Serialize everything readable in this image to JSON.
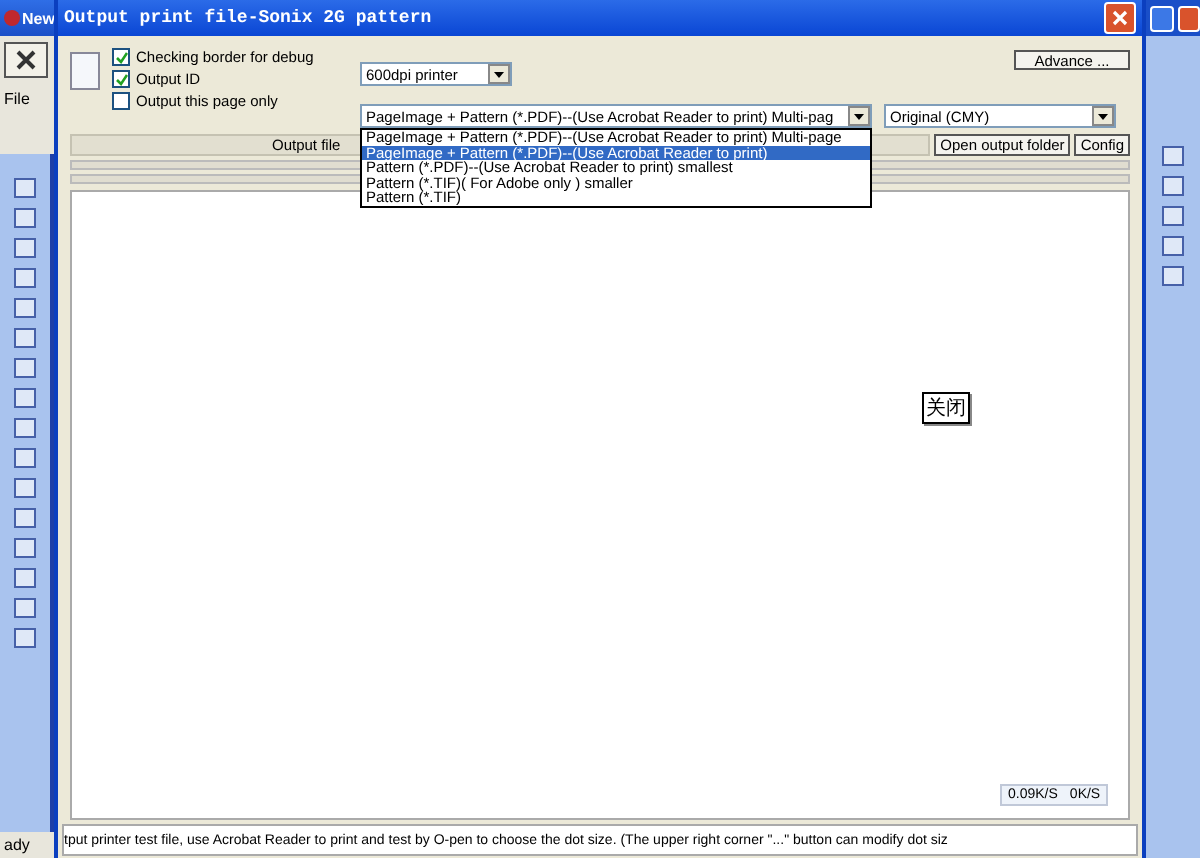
{
  "background_app": {
    "title": "New",
    "menu": [
      "File"
    ],
    "status": "ady"
  },
  "window": {
    "title": "Output print file-Sonix 2G pattern"
  },
  "options": [
    {
      "label": "Checking border for debug",
      "checked": true
    },
    {
      "label": "Output ID",
      "checked": true
    },
    {
      "label": "Output this page only",
      "checked": false
    }
  ],
  "printer_select": {
    "value": "600dpi printer"
  },
  "advance_button": "Advance ...",
  "format_select": {
    "value": "PageImage + Pattern (*.PDF)--(Use Acrobat Reader to print) Multi-pag",
    "expanded": true,
    "options": [
      {
        "label": "PageImage + Pattern (*.PDF)--(Use Acrobat Reader to print) Multi-page",
        "selected": false
      },
      {
        "label": "PageImage + Pattern (*.PDF)--(Use Acrobat Reader to print)",
        "selected": true
      },
      {
        "label": "Pattern (*.PDF)--(Use Acrobat Reader to print) smallest",
        "selected": false
      },
      {
        "label": "Pattern (*.TIF)( For Adobe only ) smaller",
        "selected": false
      },
      {
        "label": "Pattern (*.TIF)",
        "selected": false
      }
    ]
  },
  "color_select": {
    "value": "Original (CMY)"
  },
  "output_file_label": "Output file",
  "buttons": [
    "Open output folder",
    "Config"
  ],
  "tooltip": "关闭",
  "speed_widget": {
    "download": "0.09K/S",
    "upload": "0K/S"
  },
  "status_text": "tput printer test file, use Acrobat Reader to print and test by O-pen to choose the dot size. (The upper right corner \"...\" button can modify dot siz"
}
